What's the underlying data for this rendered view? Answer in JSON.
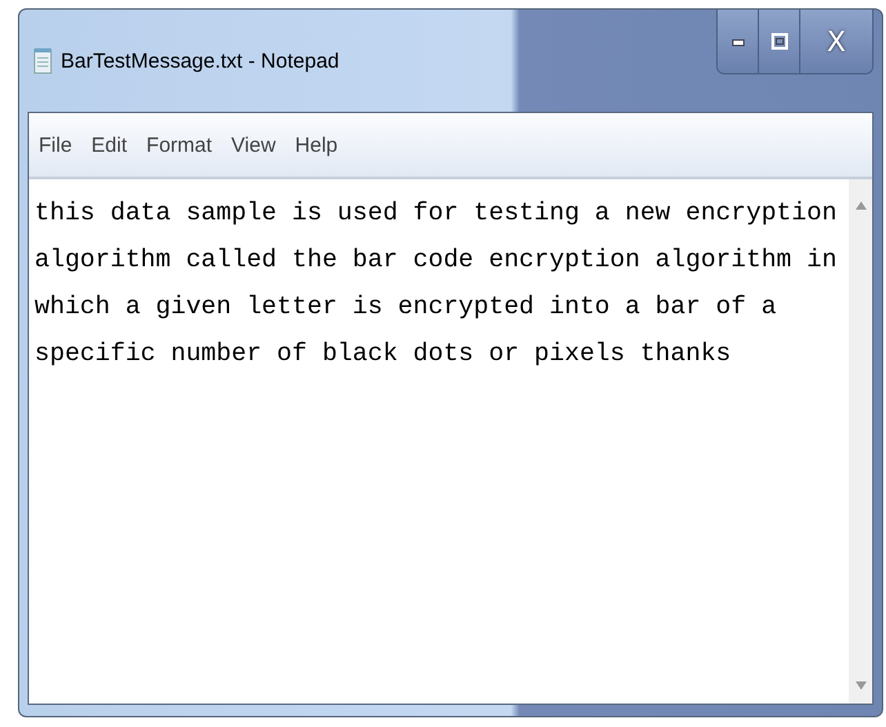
{
  "window": {
    "title": "BarTestMessage.txt - Notepad",
    "close_label": "X"
  },
  "menu": [
    "File",
    "Edit",
    "Format",
    "View",
    "Help"
  ],
  "editor": {
    "lines": [
      "this data sample is used for testing a new encryption",
      "algorithm called the bar code encryption algorithm in",
      "which a given letter is encrypted into a bar of a",
      "specific number of black dots or pixels thanks"
    ]
  }
}
